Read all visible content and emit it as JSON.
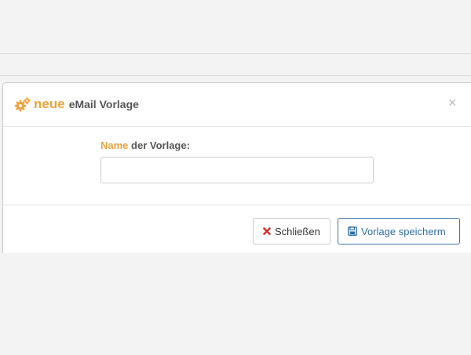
{
  "modal": {
    "title_highlight": "neue",
    "title_rest": "eMail Vorlage",
    "close_symbol": "×",
    "icon": "cogs-icon"
  },
  "form": {
    "label_highlight": "Name",
    "label_rest": " der Vorlage:",
    "name_value": "",
    "name_placeholder": ""
  },
  "footer": {
    "close_label": "Schließen",
    "save_label": "Vorlage speicherm"
  },
  "colors": {
    "accent": "#f0a23b",
    "primary_outline": "#3b73a8",
    "danger_icon": "#d9302c"
  }
}
